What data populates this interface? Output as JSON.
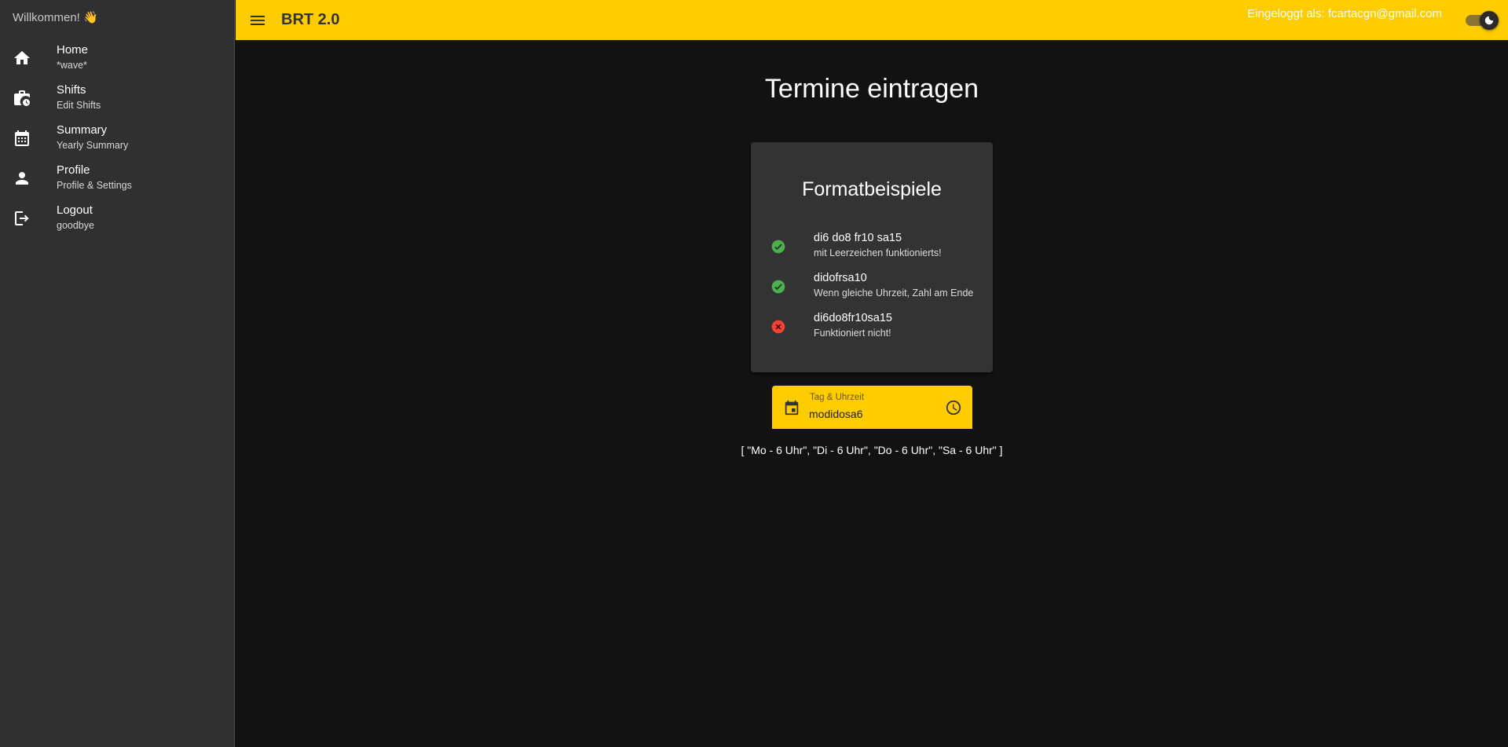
{
  "sidebar": {
    "title": "Willkommen! 👋",
    "items": [
      {
        "label": "Home",
        "sub": "*wave*",
        "icon": "home-icon"
      },
      {
        "label": "Shifts",
        "sub": "Edit Shifts",
        "icon": "work-clock-icon"
      },
      {
        "label": "Summary",
        "sub": "Yearly Summary",
        "icon": "calendar-month-icon"
      },
      {
        "label": "Profile",
        "sub": "Profile & Settings",
        "icon": "person-icon"
      },
      {
        "label": "Logout",
        "sub": "goodbye",
        "icon": "logout-icon"
      }
    ]
  },
  "appbar": {
    "title": "BRT 2.0",
    "login_info": "Eingeloggt als: fcartacgn@gmail.com",
    "menu_icon": "menu-icon",
    "theme_toggle_on": true,
    "accent_color": "#ffcc00"
  },
  "main": {
    "title": "Termine eintragen",
    "card": {
      "title": "Formatbeispiele",
      "examples": [
        {
          "code": "di6 do8 fr10 sa15",
          "desc": "mit Leerzeichen funktionierts!",
          "status": "ok",
          "icon": "check-circle-icon",
          "color": "#4caf50"
        },
        {
          "code": "didofrsa10",
          "desc": "Wenn gleiche Uhrzeit, Zahl am Ende",
          "status": "ok",
          "icon": "check-circle-icon",
          "color": "#4caf50"
        },
        {
          "code": "di6do8fr10sa15",
          "desc": "Funktioniert nicht!",
          "status": "error",
          "icon": "cancel-circle-icon",
          "color": "#f44336"
        }
      ]
    },
    "field": {
      "label": "Tag & Uhrzeit",
      "value": "modidosa6",
      "prefix_icon": "calendar-icon",
      "suffix_icon": "clock-icon"
    },
    "result": "[ \"Mo - 6 Uhr\", \"Di - 6 Uhr\", \"Do - 6 Uhr\", \"Sa - 6 Uhr\" ]"
  }
}
